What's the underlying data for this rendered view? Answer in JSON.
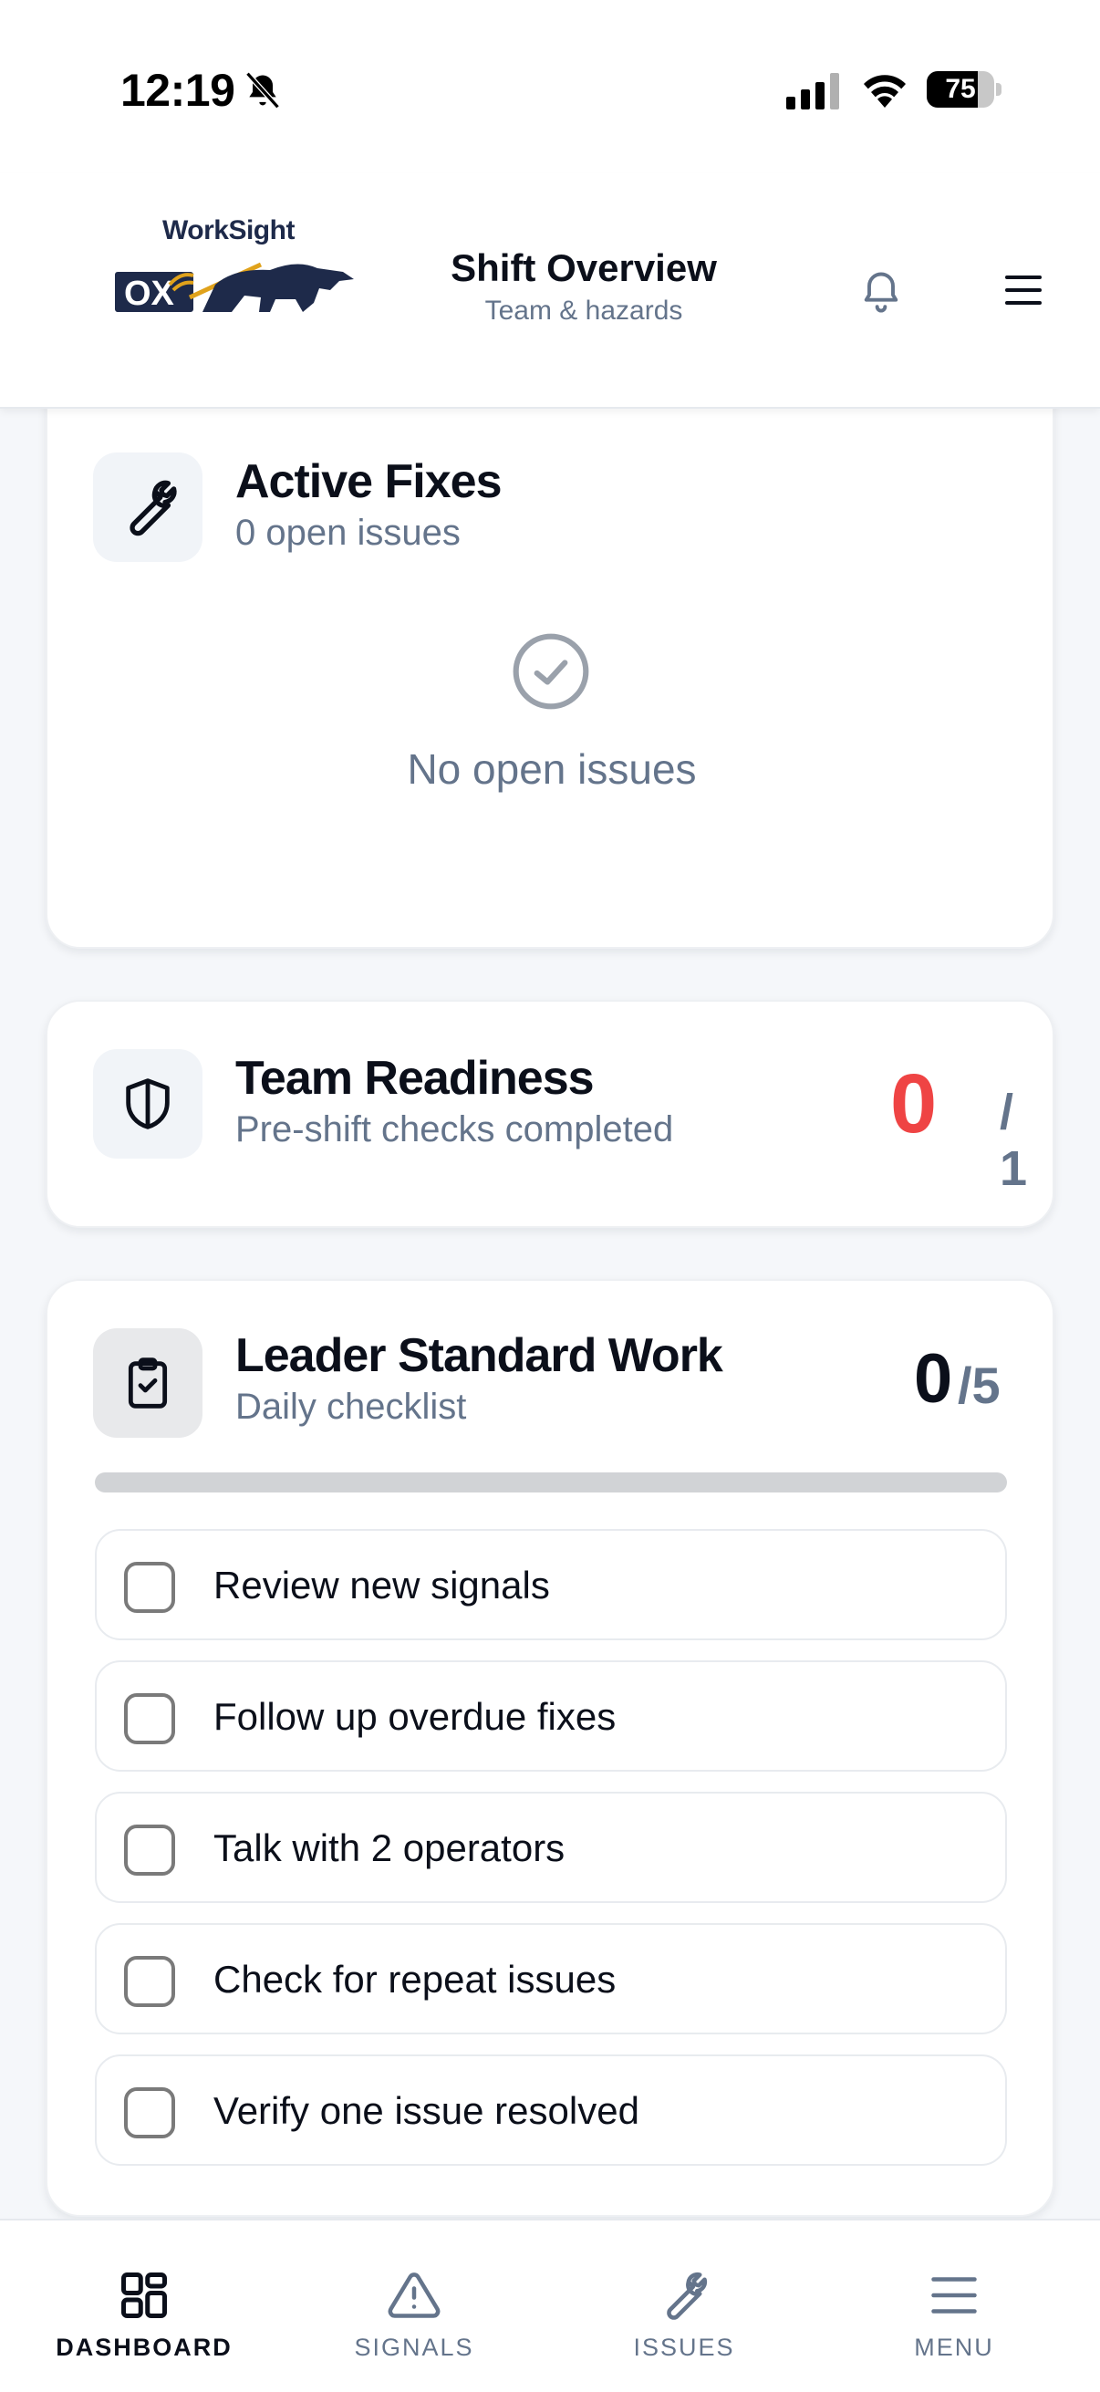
{
  "status_bar": {
    "time": "12:19",
    "battery_percent": "75",
    "battery_level": 0.75
  },
  "header": {
    "logo_text": "WorkSight",
    "logo_badge": "OX",
    "title": "Shift Overview",
    "subtitle": "Team & hazards"
  },
  "active_fixes": {
    "title": "Active Fixes",
    "subtitle": "0 open issues",
    "empty_message": "No open issues"
  },
  "team_readiness": {
    "title": "Team Readiness",
    "subtitle": "Pre-shift checks completed",
    "completed": "0",
    "total": "/ 1"
  },
  "leader_standard_work": {
    "title": "Leader Standard Work",
    "subtitle": "Daily checklist",
    "completed": "0",
    "total": "/5",
    "progress": 0,
    "items": [
      {
        "label": "Review new signals",
        "checked": false
      },
      {
        "label": "Follow up overdue fixes",
        "checked": false
      },
      {
        "label": "Talk with 2 operators",
        "checked": false
      },
      {
        "label": "Check for repeat issues",
        "checked": false
      },
      {
        "label": "Verify one issue resolved",
        "checked": false
      }
    ]
  },
  "bottom_nav": {
    "items": [
      {
        "label": "DASHBOARD",
        "icon": "grid-icon",
        "active": true
      },
      {
        "label": "SIGNALS",
        "icon": "warning-triangle-icon",
        "active": false
      },
      {
        "label": "ISSUES",
        "icon": "wrench-icon",
        "active": false
      },
      {
        "label": "MENU",
        "icon": "menu-icon",
        "active": false
      }
    ]
  },
  "colors": {
    "accent_red": "#ef4444",
    "muted": "#64748b",
    "text": "#0b0f1a",
    "brand_navy": "#1e2a4a",
    "brand_gold": "#e0a21b"
  }
}
